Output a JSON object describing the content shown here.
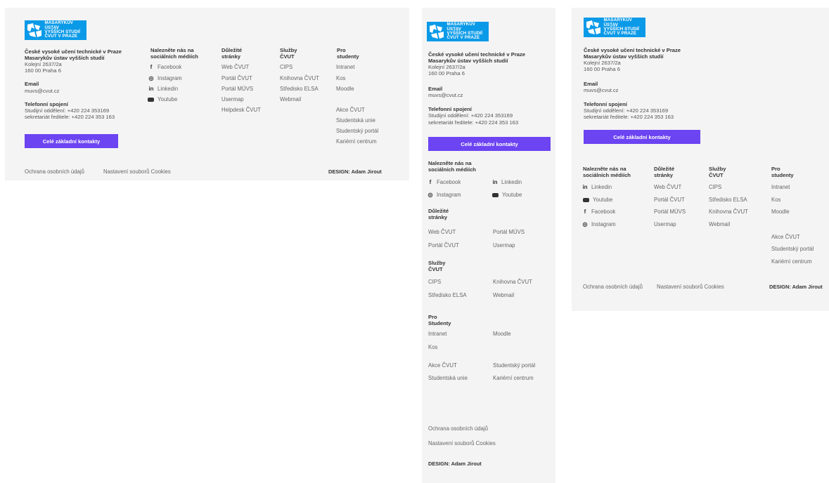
{
  "logo": {
    "line1": "MASARYKŮV ÚSTAV",
    "line2": "VYŠŠÍCH STUDIÍ",
    "line3": "ČVUT V PRAZE"
  },
  "contact": {
    "org1": "České vysoké učení technické v Praze",
    "org2": "Masarykův ústav vyšších studií",
    "street": "Kolejní 2637/2a",
    "city": "160 00 Praha 6",
    "email_title": "Email",
    "email": "muvs@cvut.cz",
    "phone_title": "Telefonní spojení",
    "phone1": "Studijní oddělení: +420 224 353169",
    "phone2": "sekretariát ředitele: +420 224 353 163",
    "button": "Celé základní kontakty"
  },
  "social": {
    "title": "Nalezněte nás na sociálních médiích",
    "facebook": "Facebook",
    "instagram": "Instagram",
    "linkedin": "Linkedin",
    "youtube": "Youtube"
  },
  "important": {
    "title": "Důležité stránky",
    "items": [
      "Web ČVUT",
      "Portál ČVUT",
      "Portál MÚVS",
      "Usermap",
      "Helpdesk ČVUT"
    ]
  },
  "services": {
    "title": "Služby ČVUT",
    "items": [
      "CIPS",
      "Knihovna ČVUT",
      "Středisko ELSA",
      "Webmail"
    ]
  },
  "students": {
    "title": "Pro studenty",
    "title_alt": "Pro Studenty",
    "items": [
      "Intranet",
      "Kos",
      "Moodle",
      "Akce ČVUT",
      "Studentská unie",
      "Studentský portál",
      "Kariérní centrum"
    ]
  },
  "footer": {
    "privacy": "Ochrana osobních údajů",
    "cookies": "Nastavení souborů Cookies",
    "design": "DESIGN: Adam Jirout"
  },
  "colors": {
    "accent": "#6c44f2",
    "logo_bg": "#0b9ae8",
    "panel_bg": "#f4f4f4"
  }
}
